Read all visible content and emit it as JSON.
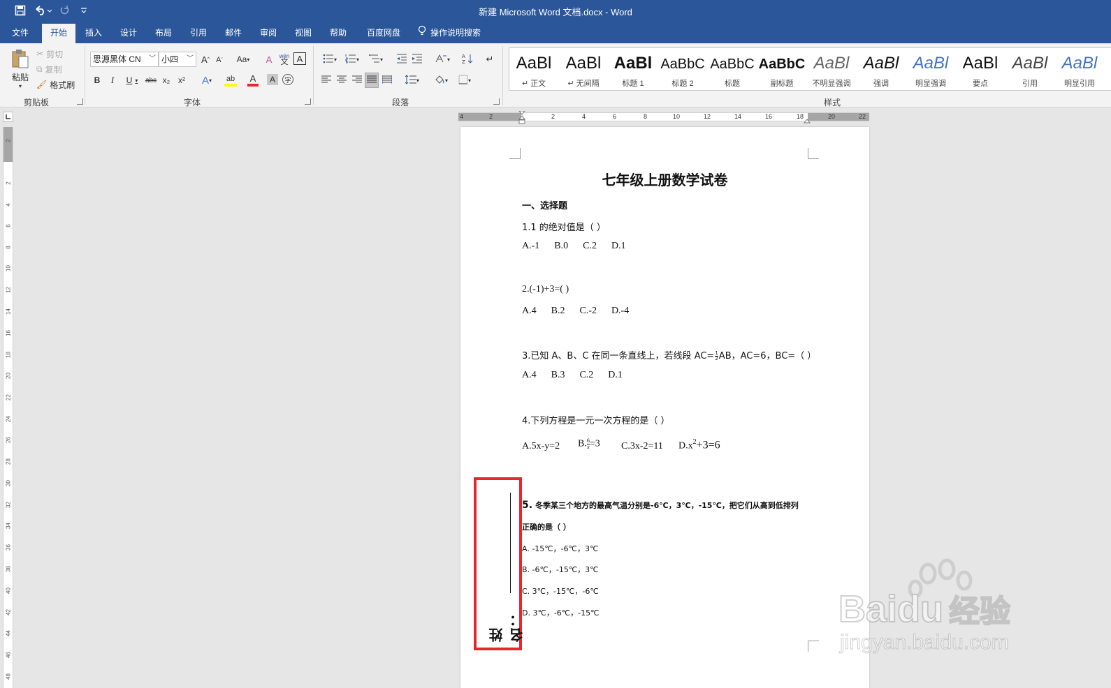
{
  "window": {
    "title": "新建 Microsoft Word 文档.docx  -  Word",
    "quick_access": [
      "save-icon",
      "undo-icon",
      "redo-icon",
      "customize-icon"
    ]
  },
  "tabs": [
    {
      "label": "文件"
    },
    {
      "label": "开始",
      "active": true
    },
    {
      "label": "插入"
    },
    {
      "label": "设计"
    },
    {
      "label": "布局"
    },
    {
      "label": "引用"
    },
    {
      "label": "邮件"
    },
    {
      "label": "审阅"
    },
    {
      "label": "视图"
    },
    {
      "label": "帮助"
    },
    {
      "label": "百度网盘"
    }
  ],
  "search": {
    "label": "操作说明搜索"
  },
  "clipboard": {
    "paste": "粘贴",
    "cut": "剪切",
    "copy": "复制",
    "format_painter": "格式刷",
    "group": "剪贴板"
  },
  "font": {
    "family": "思源黑体 CN",
    "size": "小四",
    "group": "字体",
    "grow": "A",
    "shrink": "A",
    "case": "Aa",
    "clear": "A",
    "phonetic": "wén",
    "phonetic_char": "文",
    "border_char": "A",
    "bold": "B",
    "italic": "I",
    "underline": "U",
    "strike": "abc",
    "sub": "x₂",
    "sup": "x²",
    "effects": "A",
    "highlight": "ab",
    "color": "A",
    "shade": "A",
    "enclose": "字",
    "highlight_color": "#ffff00",
    "font_color": "#e8262c"
  },
  "paragraph": {
    "group": "段落"
  },
  "styles": {
    "group": "样式",
    "items": [
      {
        "sample": "AaBl",
        "name": "↵ 正文"
      },
      {
        "sample": "AaBl",
        "name": "↵ 无间隔"
      },
      {
        "sample": "AaBl",
        "name": "标题 1"
      },
      {
        "sample": "AaBbC",
        "name": "标题 2"
      },
      {
        "sample": "AaBbC",
        "name": "标题"
      },
      {
        "sample": "AaBbC",
        "name": "副标题"
      },
      {
        "sample": "AaBl",
        "name": "不明显强调"
      },
      {
        "sample": "AaBl",
        "name": "强调"
      },
      {
        "sample": "AaBl",
        "name": "明显强调"
      },
      {
        "sample": "AaBl",
        "name": "要点"
      },
      {
        "sample": "AaBl",
        "name": "引用"
      },
      {
        "sample": "AaBl",
        "name": "明显引用"
      }
    ]
  },
  "ruler": {
    "top": [
      "4",
      "2",
      "2",
      "4",
      "6",
      "8",
      "10",
      "12",
      "14",
      "16",
      "18",
      "20",
      "22"
    ],
    "left": [
      "2",
      "2",
      "4",
      "6",
      "8",
      "10",
      "12",
      "14",
      "16",
      "18",
      "20",
      "22",
      "24",
      "26",
      "28",
      "30",
      "32",
      "34",
      "36",
      "38",
      "40",
      "42",
      "44",
      "46",
      "48"
    ]
  },
  "document": {
    "title": "七年级上册数学试卷",
    "section": "一、选择题",
    "q1": "1.1 的绝对值是（   ）",
    "q1_opts": "A.-1      B.0      C.2      D.1",
    "q2": "2.(-1)+3=(    )",
    "q2_opts": "A.4      B.2      C.-2      D.-4",
    "q3_a": "3.已知 A、B、C 在同一条直线上，若线段 AC=",
    "q3_num": "1",
    "q3_den": "2",
    "q3_b": "AB，AC=6，BC=（     ）",
    "q3_opts": "A.4      B.3      C.2      D.1",
    "q4": "4.下列方程是一元一次方程的是（     ）",
    "q4_a": "A.5x-y=2",
    "q4_b_pre": "B.",
    "q4_b_num": "6",
    "q4_b_den": "x",
    "q4_b_post": "=3",
    "q4_c": "C.3x-2=11",
    "q4_d_pre": "D.x",
    "q4_d_sup": "2",
    "q4_d_post": "+3=6",
    "q5_num": "5.",
    "q5_text": "冬季某三个地方的最高气温分别是-6℃，3℃，-15℃，把它们从高到低排列",
    "q5_text2": "正确的是（     ）",
    "q5_a": "A. -15℃，-6℃，3℃",
    "q5_b": "B. -6℃，-15℃，3℃",
    "q5_c": "C. 3℃，-15℃，-6℃",
    "q5_d": "D. 3℃，-6℃，-15℃",
    "name_label": "姓名：",
    "highlight_color": "#e8262c"
  },
  "watermark": {
    "brand": "Baidu",
    "brand_cn": "经验",
    "url": "jingyan.baidu.com"
  }
}
